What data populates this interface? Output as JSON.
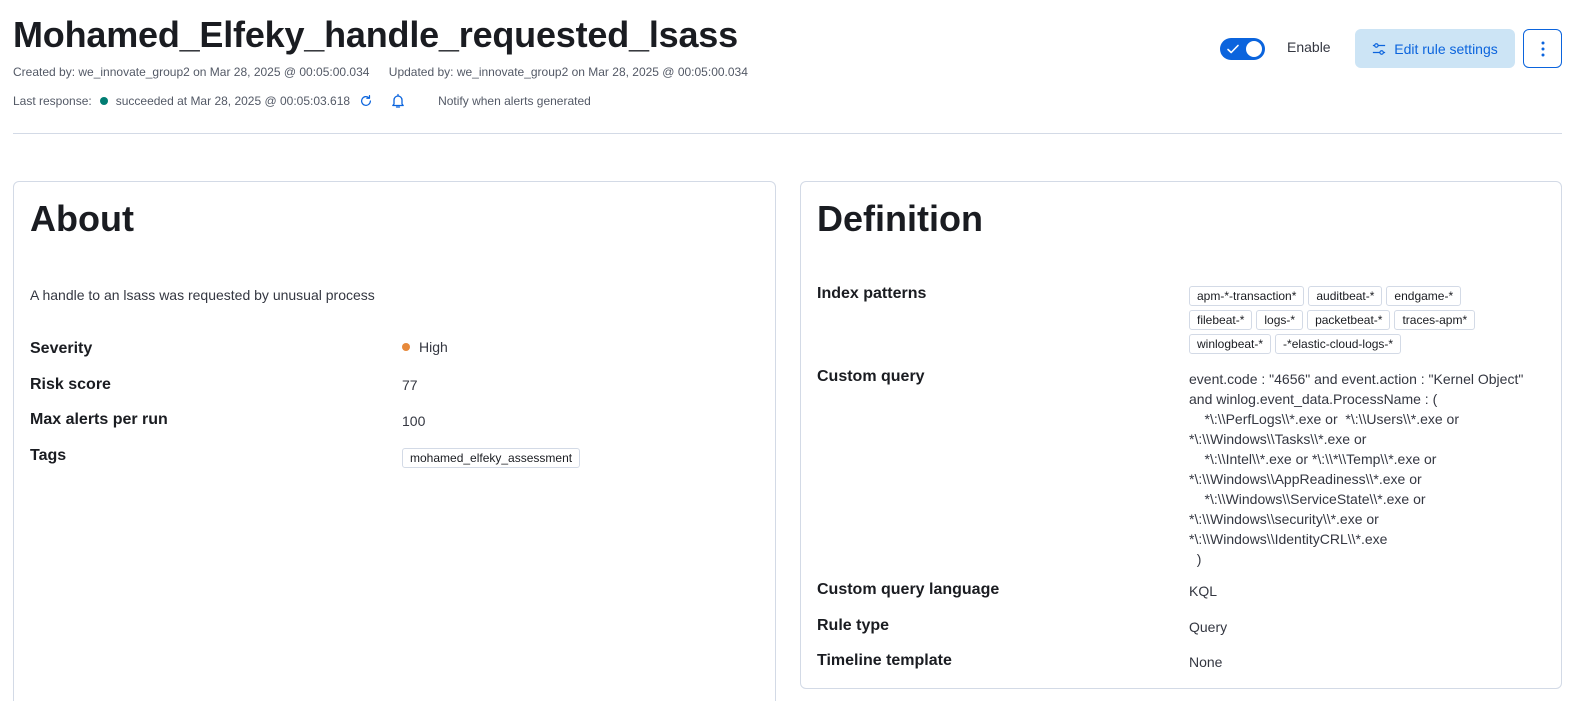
{
  "header": {
    "title": "Mohamed_Elfeky_handle_requested_lsass",
    "created_by": "Created by: we_innovate_group2 on Mar 28, 2025 @ 00:05:00.034",
    "updated_by": "Updated by: we_innovate_group2 on Mar 28, 2025 @ 00:05:00.034",
    "last_response_label": "Last response:",
    "last_response_value": "succeeded at Mar 28, 2025 @ 00:05:03.618",
    "notify_text": "Notify when alerts generated",
    "enable_label": "Enable",
    "enabled": true,
    "edit_button_label": "Edit rule settings"
  },
  "about": {
    "title": "About",
    "description": "A handle to an lsass was requested by unusual process",
    "severity_label": "Severity",
    "severity_value": "High",
    "risk_score_label": "Risk score",
    "risk_score_value": "77",
    "max_alerts_label": "Max alerts per run",
    "max_alerts_value": "100",
    "tags_label": "Tags",
    "tags": [
      "mohamed_elfeky_assessment"
    ]
  },
  "definition": {
    "title": "Definition",
    "index_patterns_label": "Index patterns",
    "index_patterns": [
      "apm-*-transaction*",
      "auditbeat-*",
      "endgame-*",
      "filebeat-*",
      "logs-*",
      "packetbeat-*",
      "traces-apm*",
      "winlogbeat-*",
      "-*elastic-cloud-logs-*"
    ],
    "custom_query_label": "Custom query",
    "custom_query": "event.code : \"4656\" and event.action : \"Kernel Object\"\nand winlog.event_data.ProcessName : (\n    *\\:\\\\PerfLogs\\\\*.exe or  *\\:\\\\Users\\\\*.exe or\n*\\:\\\\Windows\\\\Tasks\\\\*.exe or\n    *\\:\\\\Intel\\\\*.exe or *\\:\\\\*\\\\Temp\\\\*.exe or\n*\\:\\\\Windows\\\\AppReadiness\\\\*.exe or\n    *\\:\\\\Windows\\\\ServiceState\\\\*.exe or\n*\\:\\\\Windows\\\\security\\\\*.exe or\n*\\:\\\\Windows\\\\IdentityCRL\\\\*.exe\n  )",
    "query_language_label": "Custom query language",
    "query_language_value": "KQL",
    "rule_type_label": "Rule type",
    "rule_type_value": "Query",
    "timeline_label": "Timeline template",
    "timeline_value": "None"
  },
  "colors": {
    "accent": "#0b64dd",
    "success_dot": "#017d73",
    "severity_high": "#e7893b"
  }
}
